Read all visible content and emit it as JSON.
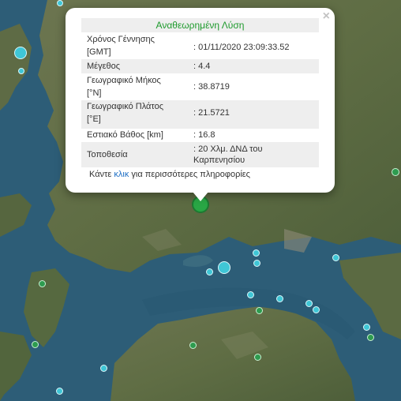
{
  "popup": {
    "title": "Αναθεωρημένη Λύση",
    "close_icon": "×",
    "rows": [
      {
        "label": "Χρόνος Γέννησης [GMT]",
        "label_l1": "Χρόνος Γέννησης",
        "label_l2": "[GMT]",
        "value": ": 01/11/2020 23:09:33.52"
      },
      {
        "label": "Μέγεθος",
        "value": ": 4.4"
      },
      {
        "label": "Γεωγραφικό Μήκος [°N]",
        "label_l1": "Γεωγραφικό Μήκος",
        "label_l2": "[°N]",
        "value": ": 38.8719"
      },
      {
        "label": "Γεωγραφικό Πλάτος [°E]",
        "label_l1": "Γεωγραφικό Πλάτος",
        "label_l2": "[°E]",
        "value": ": 21.5721"
      },
      {
        "label": "Εστιακό Βάθος [km]",
        "value": ": 16.8"
      },
      {
        "label": "Τοποθεσία",
        "value_l1": ": 20 Χλμ. ΔΝΔ του",
        "value_l2": "Καρπενησίου"
      }
    ],
    "more_prefix": "Κάντε ",
    "more_link": "κλικ",
    "more_suffix": " για περισσότερες πληροφορίες"
  },
  "colors": {
    "title_green": "#1d9a2c",
    "link_blue": "#1f6fc5",
    "marker_cyan": "#3fc6d6",
    "marker_green": "#2e9b4f"
  }
}
